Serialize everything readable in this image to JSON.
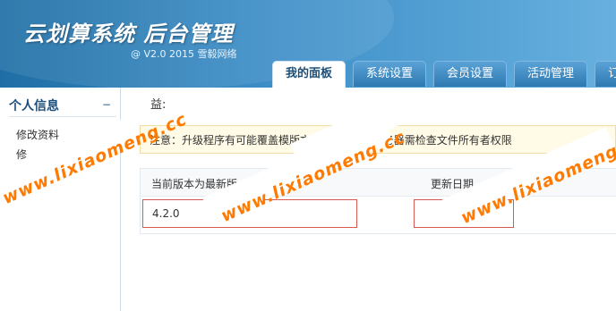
{
  "header": {
    "title": "云划算系统  后台管理",
    "subtitle": "@ V2.0 2015 雪毅网络"
  },
  "nav": {
    "tabs": [
      {
        "label": "我的面板"
      },
      {
        "label": "系统设置"
      },
      {
        "label": "会员设置"
      },
      {
        "label": "活动管理"
      },
      {
        "label": "订单"
      }
    ]
  },
  "sidebar": {
    "heading": "个人信息",
    "items": [
      {
        "label": "修改资料"
      },
      {
        "label": "修"
      }
    ]
  },
  "main": {
    "block_title": "益:",
    "notice": "注意：升级程序有可能覆盖模版文            备份！linux服务器需检查文件所有者权限",
    "current_version_label": "当前版本为最新版",
    "current_version_value": "4.2.0",
    "update_date_label": "更新日期"
  },
  "watermark": {
    "text": "www.lixiaomeng.cc"
  },
  "colors": {
    "header": "#3e8fc8",
    "watermark": "#ff7a00",
    "highlight_border": "#d75a52"
  }
}
